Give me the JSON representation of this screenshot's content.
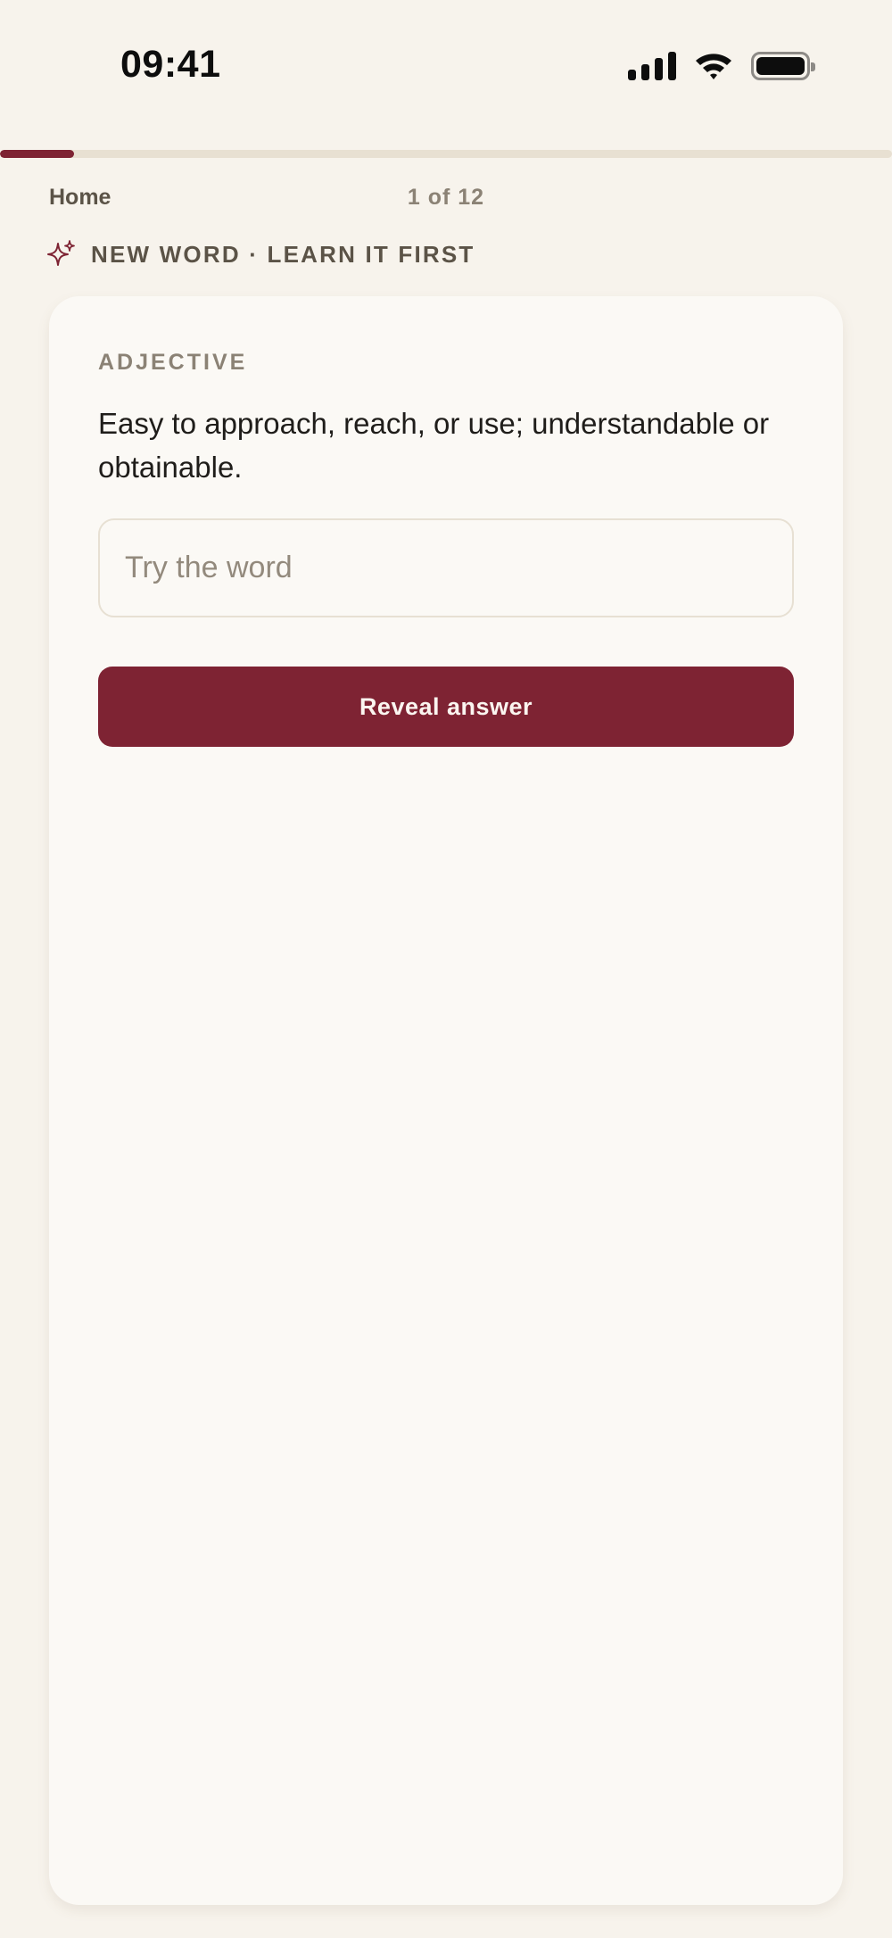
{
  "status_bar": {
    "time": "09:41",
    "icons": [
      "cellular-signal-icon",
      "wifi-icon",
      "battery-icon"
    ]
  },
  "progress": {
    "current": 1,
    "total": 12,
    "fraction": 0.0833,
    "color": "#7E2333"
  },
  "nav": {
    "home_label": "Home",
    "counter_text": "1 of 12"
  },
  "tag": {
    "icon": "sparkles-icon",
    "text": "NEW WORD · LEARN IT FIRST"
  },
  "card": {
    "part_of_speech": "ADJECTIVE",
    "definition": "Easy to approach, reach, or use; understandable or obtainable.",
    "input": {
      "value": "",
      "placeholder": "Try the word"
    },
    "reveal_label": "Reveal answer"
  },
  "colors": {
    "background": "#F7F3EC",
    "card": "#FBF9F5",
    "accent": "#7E2333",
    "muted_text": "#8b8275"
  }
}
